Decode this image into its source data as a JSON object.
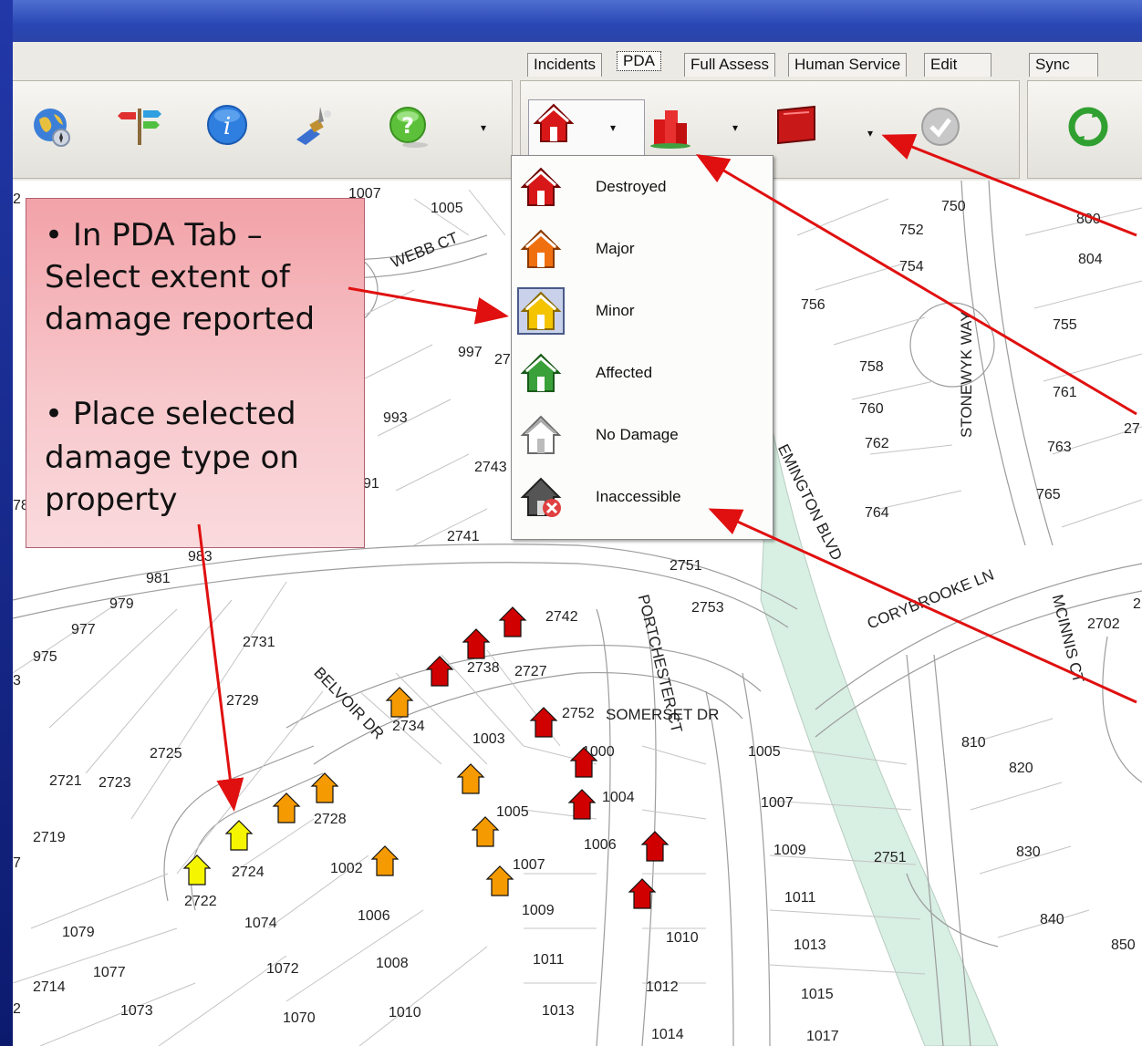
{
  "ribbon": {
    "tabs": [
      "Incidents",
      "PDA",
      "Full Assess",
      "Human Service",
      "Edit"
    ],
    "active_tab": "PDA",
    "sync_tab": "Sync"
  },
  "icons": {
    "toolbar": [
      "globe-icon",
      "signpost-icon",
      "info-icon",
      "satellite-icon",
      "help-icon"
    ],
    "pda": [
      "house-damage-icon",
      "building-damage-icon",
      "flag-icon",
      "check-icon"
    ],
    "sync": "sync-icon"
  },
  "damage_menu": {
    "items": [
      {
        "label": "Destroyed",
        "color": "#d01010"
      },
      {
        "label": "Major",
        "color": "#f07010"
      },
      {
        "label": "Minor",
        "color": "#f4c400"
      },
      {
        "label": "Affected",
        "color": "#3aa03a"
      },
      {
        "label": "No Damage",
        "color": "#ffffff"
      },
      {
        "label": "Inaccessible",
        "color": "#555555"
      }
    ],
    "selected": "Minor"
  },
  "callout": {
    "line1": "• In PDA Tab –",
    "line2": "Select extent of",
    "line3": "damage reported",
    "line4": "• Place selected",
    "line5": "damage type on",
    "line6": "property"
  },
  "streets": {
    "webb": "WEBB CT",
    "belvoir": "BELVOIR DR",
    "somerset": "SOMERSET DR",
    "portchester": "PORTCHESTER CT",
    "stonewyk": "STONEWYK WAY",
    "corybrooke": "CORYBROOKE LN",
    "mcinnis": "MCINNIS CT",
    "blvd": "EMINGTON BLVD"
  },
  "parcels": [
    "1007",
    "1005",
    "750",
    "800",
    "752",
    "804",
    "754",
    "756",
    "755",
    "997",
    "758",
    "993",
    "760",
    "761",
    "2743",
    "763",
    "762",
    "765",
    "764",
    "2741",
    "983",
    "2751",
    "981",
    "2753",
    "979",
    "2742",
    "977",
    "2731",
    "975",
    "2738",
    "2727",
    "2729",
    "2752",
    "2734",
    "1003",
    "2725",
    "1000",
    "1005",
    "2721",
    "2723",
    "1004",
    "2728",
    "2719",
    "1005",
    "1006",
    "1002",
    "2724",
    "1007",
    "2722",
    "1009",
    "1074",
    "1006",
    "1079",
    "1077",
    "1072",
    "1008",
    "1011",
    "2714",
    "1073",
    "1070",
    "1010",
    "1013",
    "1012",
    "1014",
    "1009",
    "1011",
    "1010",
    "1013",
    "1015",
    "1017",
    "2751",
    "810",
    "820",
    "830",
    "840",
    "850",
    "1007",
    "2702",
    "2",
    "27",
    "2",
    "91",
    "78",
    "3",
    "27",
    "2",
    "7"
  ],
  "colors": {
    "destroyed": "#d00000",
    "major": "#f59a00",
    "minor": "#f5f500",
    "callout_fill": "#f4b0b6",
    "arrow": "#e01010",
    "greenway": "#d8efe3"
  }
}
